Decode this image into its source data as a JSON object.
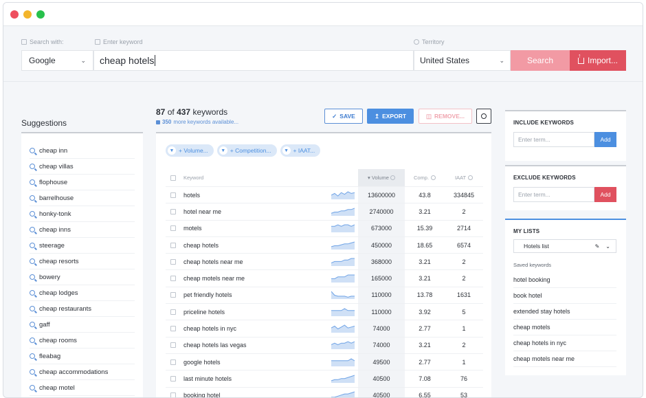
{
  "window": {
    "controls": [
      "close",
      "minimize",
      "maximize"
    ]
  },
  "search": {
    "engine_label": "Search with:",
    "engine_value": "Google",
    "keyword_label": "Enter keyword",
    "keyword_value": "cheap hotels",
    "territory_label": "Territory",
    "territory_value": "United States",
    "search_button": "Search",
    "import_button": "Import..."
  },
  "suggestions": {
    "title": "Suggestions",
    "items": [
      "cheap inn",
      "cheap villas",
      "flophouse",
      "barrelhouse",
      "honky-tonk",
      "cheap inns",
      "steerage",
      "cheap resorts",
      "bowery",
      "cheap lodges",
      "cheap restaurants",
      "gaff",
      "cheap rooms",
      "fleabag",
      "cheap accommodations",
      "cheap motel"
    ]
  },
  "results": {
    "count_shown": "87",
    "count_of": "of",
    "count_total": "437",
    "count_suffix": "keywords",
    "more_count": "350",
    "more_text": "more keywords available...",
    "save_button": "SAVE",
    "export_button": "EXPORT",
    "remove_button": "REMOVE...",
    "filters": [
      "+ Volume...",
      "+ Competition...",
      "+ IAAT..."
    ],
    "columns": {
      "keyword": "Keyword",
      "volume": "Volume",
      "comp": "Comp.",
      "iaat": "IAAT"
    },
    "rows": [
      {
        "keyword": "hotels",
        "volume": "13600000",
        "comp": "43.8",
        "iaat": "334845",
        "trend": [
          5,
          7,
          4,
          8,
          6,
          9,
          7,
          8
        ]
      },
      {
        "keyword": "hotel near me",
        "volume": "2740000",
        "comp": "3.21",
        "iaat": "2",
        "trend": [
          2,
          3,
          3,
          4,
          4,
          5,
          5,
          6
        ]
      },
      {
        "keyword": "motels",
        "volume": "673000",
        "comp": "15.39",
        "iaat": "2714",
        "trend": [
          4,
          4,
          5,
          4,
          5,
          5,
          4,
          5
        ]
      },
      {
        "keyword": "cheap hotels",
        "volume": "450000",
        "comp": "18.65",
        "iaat": "6574",
        "trend": [
          3,
          4,
          4,
          5,
          6,
          6,
          7,
          8
        ]
      },
      {
        "keyword": "cheap hotels near me",
        "volume": "368000",
        "comp": "3.21",
        "iaat": "2",
        "trend": [
          2,
          3,
          3,
          3,
          4,
          4,
          5,
          5
        ]
      },
      {
        "keyword": "cheap motels near me",
        "volume": "165000",
        "comp": "3.21",
        "iaat": "2",
        "trend": [
          2,
          2,
          3,
          3,
          3,
          4,
          4,
          4
        ]
      },
      {
        "keyword": "pet friendly hotels",
        "volume": "110000",
        "comp": "13.78",
        "iaat": "1631",
        "trend": [
          8,
          4,
          3,
          3,
          3,
          2,
          3,
          3
        ]
      },
      {
        "keyword": "priceline hotels",
        "volume": "110000",
        "comp": "3.92",
        "iaat": "5",
        "trend": [
          3,
          3,
          3,
          3,
          4,
          3,
          3,
          3
        ]
      },
      {
        "keyword": "cheap hotels in nyc",
        "volume": "74000",
        "comp": "2.77",
        "iaat": "1",
        "trend": [
          5,
          7,
          4,
          6,
          8,
          5,
          6,
          7
        ]
      },
      {
        "keyword": "cheap hotels las vegas",
        "volume": "74000",
        "comp": "3.21",
        "iaat": "2",
        "trend": [
          3,
          4,
          3,
          4,
          4,
          5,
          4,
          5
        ]
      },
      {
        "keyword": "google hotels",
        "volume": "49500",
        "comp": "2.77",
        "iaat": "1",
        "trend": [
          3,
          3,
          3,
          3,
          3,
          3,
          4,
          3
        ]
      },
      {
        "keyword": "last minute hotels",
        "volume": "40500",
        "comp": "7.08",
        "iaat": "76",
        "trend": [
          2,
          3,
          3,
          4,
          4,
          5,
          6,
          7
        ]
      },
      {
        "keyword": "booking hotel",
        "volume": "40500",
        "comp": "6.55",
        "iaat": "53",
        "trend": [
          2,
          2,
          3,
          4,
          5,
          5,
          6,
          7
        ]
      }
    ]
  },
  "include": {
    "title": "INCLUDE KEYWORDS",
    "placeholder": "Enter term...",
    "add": "Add"
  },
  "exclude": {
    "title": "EXCLUDE KEYWORDS",
    "placeholder": "Enter term...",
    "add": "Add"
  },
  "lists": {
    "title": "MY LISTS",
    "selected": "Hotels list",
    "saved_label": "Saved keywords",
    "saved": [
      "hotel booking",
      "book hotel",
      "extended stay hotels",
      "cheap motels",
      "cheap hotels in nyc",
      "cheap motels near me"
    ]
  },
  "colors": {
    "accent_blue": "#4c8fe0",
    "accent_red": "#e0515f",
    "search_pink": "#f29aa4"
  }
}
